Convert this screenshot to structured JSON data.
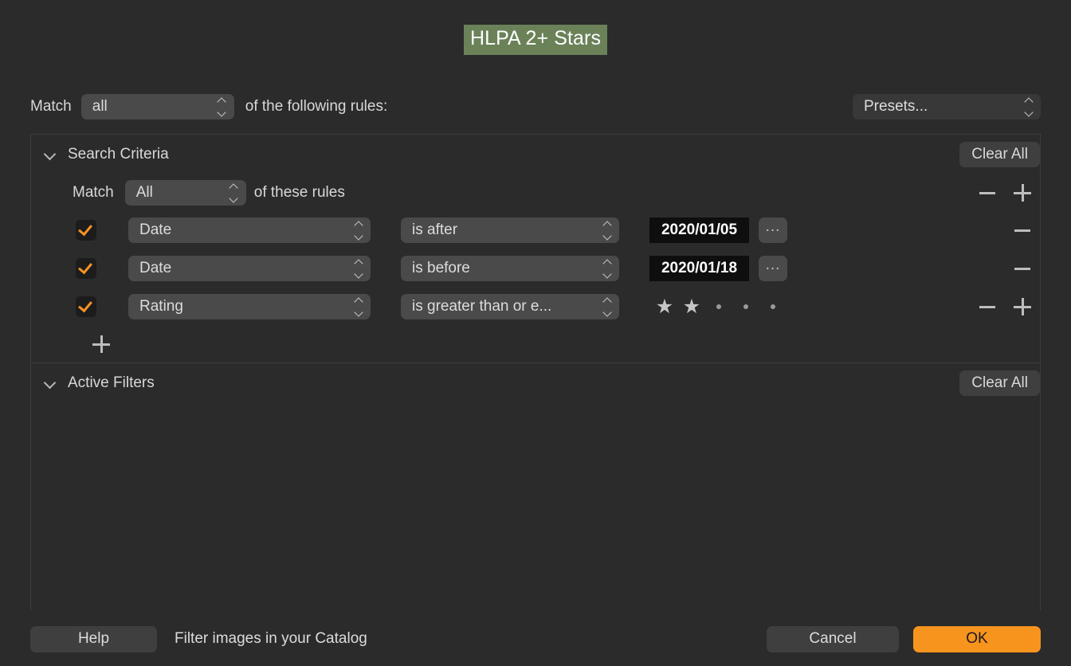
{
  "window": {
    "title": "HLPA 2+ Stars",
    "title_highlight_color": "#6b8259"
  },
  "top_bar": {
    "match_label": "Match",
    "match_value": "all",
    "suffix_label": "of the following rules:",
    "presets_label": "Presets..."
  },
  "search_criteria": {
    "section_title": "Search Criteria",
    "clear_all_label": "Clear All",
    "inner_match_label": "Match",
    "inner_match_value": "All",
    "inner_match_suffix": "of these rules",
    "rules": [
      {
        "checked": true,
        "field": "Date",
        "operator": "is after",
        "value": "2020/01/05",
        "more_label": "...",
        "has_plus": false
      },
      {
        "checked": true,
        "field": "Date",
        "operator": "is before",
        "value": "2020/01/18",
        "more_label": "...",
        "has_plus": false
      },
      {
        "checked": true,
        "field": "Rating",
        "operator": "is greater than or e...",
        "rating": 2,
        "rating_max": 5,
        "has_plus": true
      }
    ]
  },
  "active_filters": {
    "section_title": "Active Filters",
    "clear_all_label": "Clear All"
  },
  "footer": {
    "help_label": "Help",
    "note": "Filter images in your Catalog",
    "cancel_label": "Cancel",
    "ok_label": "OK",
    "ok_color": "#f7941e"
  }
}
